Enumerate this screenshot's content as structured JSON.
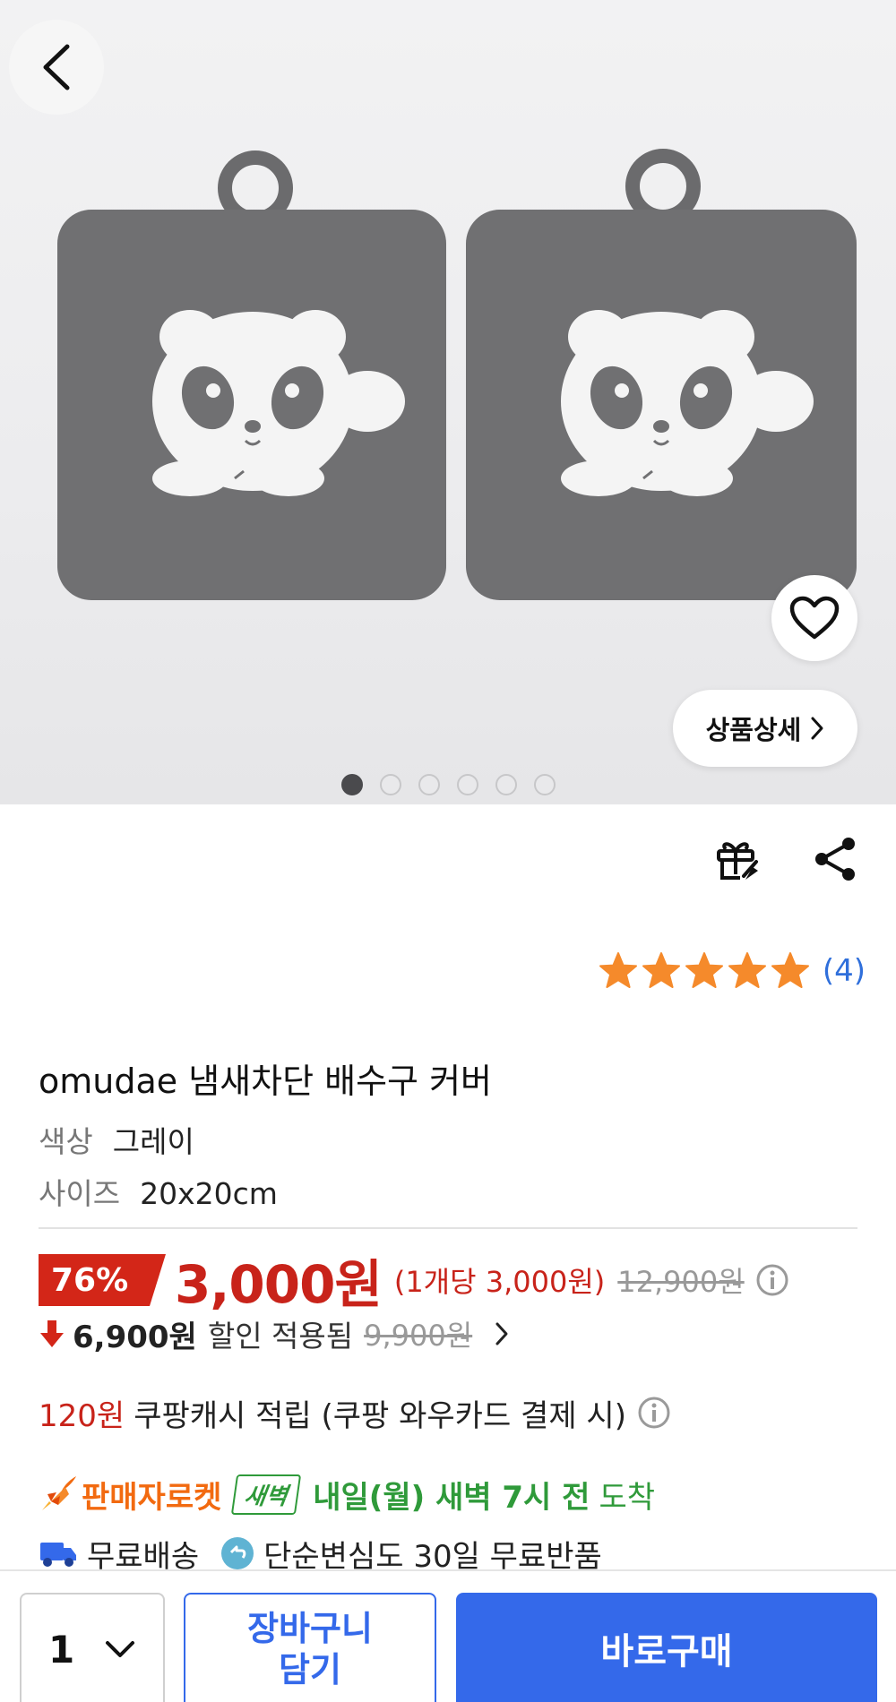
{
  "gallery": {
    "image_count": 6,
    "active_index": 0,
    "detail_label": "상품상세"
  },
  "icons": {
    "back": "chevron-left-icon",
    "wishlist": "heart-icon",
    "gift": "gift-icon",
    "share": "share-icon",
    "info": "info-icon",
    "discount_arrow": "arrow-down-icon",
    "rocket": "rocket-icon",
    "truck": "truck-icon",
    "return": "return-icon",
    "chevron": "chevron-right-icon"
  },
  "rating": {
    "stars": 5,
    "count_label": "(4)"
  },
  "product": {
    "title": "omudae 냄새차단 배수구 커버",
    "options": [
      {
        "key": "색상",
        "value": "그레이"
      },
      {
        "key": "사이즈",
        "value": "20x20cm"
      }
    ]
  },
  "price": {
    "discount_badge": "76%",
    "sale_price": "3,000원",
    "unit_price": "(1개당 3,000원)",
    "original_price": "12,900원",
    "coupon_price": "6,900원",
    "coupon_text": "할인 적용됨",
    "coupon_original": "9,900원"
  },
  "cashback": {
    "amount": "120원",
    "text": "쿠팡캐시 적립 (쿠팡 와우카드 결제 시)"
  },
  "shipping": {
    "rocket_label": "판매자로켓",
    "dawn_badge": "새벽",
    "arrival_emphasis": "내일(월) 새벽 7시 전",
    "arrival_word": "도착",
    "free_shipping": "무료배송",
    "free_return": "단순변심도 30일 무료반품"
  },
  "bottom_bar": {
    "quantity": "1",
    "cart_label": "장바구니 담기",
    "buy_label": "바로구매"
  },
  "colors": {
    "accent_blue": "#3469ea",
    "price_red": "#c8231a",
    "star_orange": "#f58a2b",
    "rocket_orange": "#f26a10",
    "dawn_green": "#2f9a3a"
  }
}
